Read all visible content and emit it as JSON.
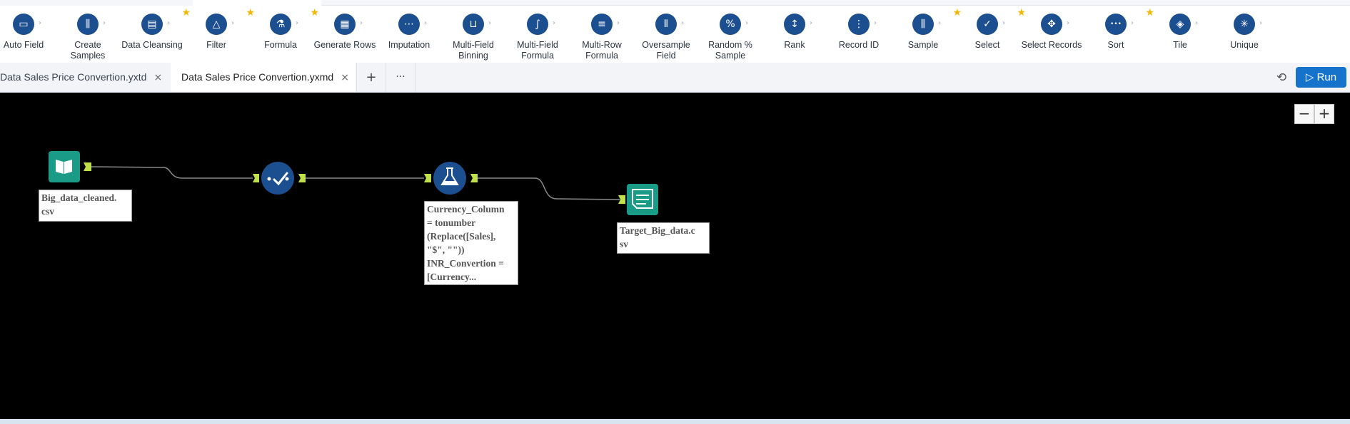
{
  "tools": [
    {
      "label": "Auto Field",
      "icon": "auto-field-icon",
      "glyph": "▭",
      "star": false
    },
    {
      "label": "Create\nSamples",
      "icon": "create-samples-icon",
      "glyph": "⫼",
      "star": false
    },
    {
      "label": "Data Cleansing",
      "icon": "data-cleansing-icon",
      "glyph": "▤",
      "star": true
    },
    {
      "label": "Filter",
      "icon": "filter-icon",
      "glyph": "△",
      "star": true
    },
    {
      "label": "Formula",
      "icon": "formula-icon",
      "glyph": "⚗",
      "star": true
    },
    {
      "label": "Generate Rows",
      "icon": "generate-rows-icon",
      "glyph": "▦",
      "star": false
    },
    {
      "label": "Imputation",
      "icon": "imputation-icon",
      "glyph": "⋯",
      "star": false
    },
    {
      "label": "Multi-Field\nBinning",
      "icon": "multi-field-binning-icon",
      "glyph": "⊔",
      "star": false
    },
    {
      "label": "Multi-Field\nFormula",
      "icon": "multi-field-formula-icon",
      "glyph": "∫",
      "star": false
    },
    {
      "label": "Multi-Row\nFormula",
      "icon": "multi-row-formula-icon",
      "glyph": "≡",
      "star": false
    },
    {
      "label": "Oversample\nField",
      "icon": "oversample-field-icon",
      "glyph": "⫴",
      "star": false
    },
    {
      "label": "Random %\nSample",
      "icon": "random-sample-icon",
      "glyph": "%",
      "star": false
    },
    {
      "label": "Rank",
      "icon": "rank-icon",
      "glyph": "↕",
      "star": false
    },
    {
      "label": "Record ID",
      "icon": "record-id-icon",
      "glyph": "⋮",
      "star": false
    },
    {
      "label": "Sample",
      "icon": "sample-icon",
      "glyph": "⫼",
      "star": true
    },
    {
      "label": "Select",
      "icon": "select-icon",
      "glyph": "✓",
      "star": true
    },
    {
      "label": "Select Records",
      "icon": "select-records-icon",
      "glyph": "✥",
      "star": false
    },
    {
      "label": "Sort",
      "icon": "sort-icon",
      "glyph": "•••",
      "star": true
    },
    {
      "label": "Tile",
      "icon": "tile-icon",
      "glyph": "◈",
      "star": false
    },
    {
      "label": "Unique",
      "icon": "unique-icon",
      "glyph": "✳",
      "star": false
    }
  ],
  "tabs": [
    {
      "label": "Data Sales Price Convertion.yxtd",
      "active": false
    },
    {
      "label": "Data Sales Price Convertion.yxmd",
      "active": true
    }
  ],
  "tab_close": "×",
  "tab_add": "+",
  "tab_more": "···",
  "run_label": "Run",
  "zoom_out": "−",
  "zoom_in": "+",
  "nodes": {
    "input": {
      "annotation": "Big_data_cleaned.\ncsv"
    },
    "select": {},
    "formula": {
      "annotation": "Currency_Column\n= tonumber\n(Replace([Sales],\n\"$\", \"\"))\nINR_Convertion =\n[Currency..."
    },
    "output": {
      "annotation": "Target_Big_data.c\nsv"
    }
  },
  "colors": {
    "tool_icon": "#1c4f8f",
    "node_teal": "#1a9b88",
    "node_blue": "#1c4f8f",
    "anchor_green": "#bfe04a",
    "star": "#f2b705",
    "run": "#1673cc",
    "canvas": "#000000"
  }
}
